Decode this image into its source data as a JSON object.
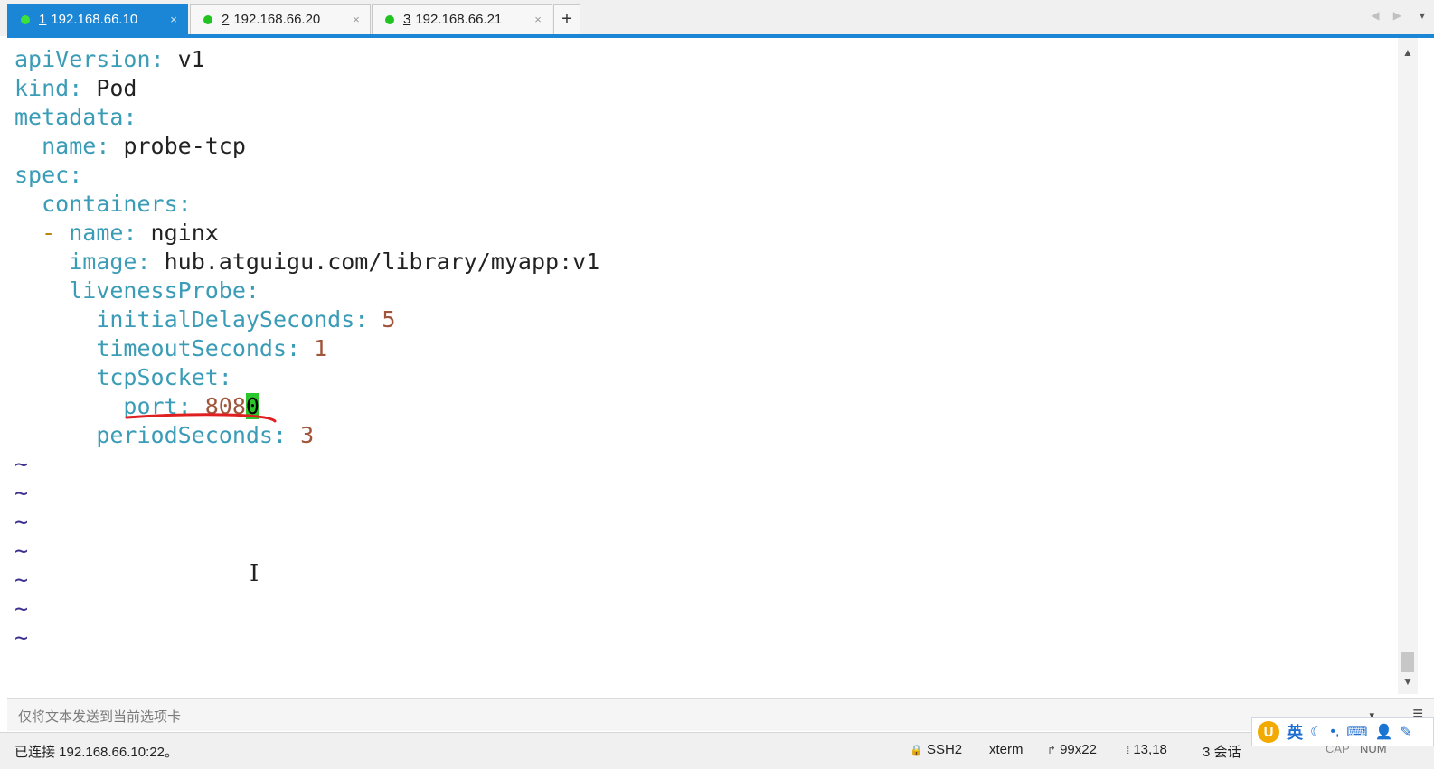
{
  "tabs": [
    {
      "number": "1",
      "label": "192.168.66.10",
      "close": "×"
    },
    {
      "number": "2",
      "label": "192.168.66.20",
      "close": "×"
    },
    {
      "number": "3",
      "label": "192.168.66.21",
      "close": "×"
    }
  ],
  "new_tab": "+",
  "tab_nav": "◀ ▶",
  "tab_menu": "▾",
  "editor": {
    "lines": [
      {
        "key": "apiVersion",
        "sep": ": ",
        "value": "v1"
      },
      {
        "key": "kind",
        "sep": ": ",
        "value": "Pod"
      },
      {
        "key": "metadata",
        "sep": ":"
      },
      {
        "indent": "  ",
        "key": "name",
        "sep": ": ",
        "value": "probe-tcp"
      },
      {
        "key": "spec",
        "sep": ":"
      },
      {
        "indent": "  ",
        "key": "containers",
        "sep": ":"
      },
      {
        "indent": "  ",
        "dash": "- ",
        "key": "name",
        "sep": ": ",
        "value": "nginx"
      },
      {
        "indent": "    ",
        "key": "image",
        "sep": ": ",
        "value": "hub.atguigu.com/library/myapp:v1"
      },
      {
        "indent": "    ",
        "key": "livenessProbe",
        "sep": ":"
      },
      {
        "indent": "      ",
        "key": "initialDelaySeconds",
        "sep": ": ",
        "number": "5"
      },
      {
        "indent": "      ",
        "key": "timeoutSeconds",
        "sep": ": ",
        "number": "1"
      },
      {
        "indent": "      ",
        "key": "tcpSocket",
        "sep": ":"
      },
      {
        "indent": "        ",
        "key": "port",
        "sep": ": ",
        "number": "808",
        "cursor": "0"
      },
      {
        "indent": "      ",
        "key": "periodSeconds",
        "sep": ": ",
        "number": "3"
      }
    ],
    "tilde": "~",
    "tilde_count": 7,
    "highlight_color": "#e02020"
  },
  "sendbar": {
    "placeholder": "仅将文本发送到当前选项卡",
    "dropdown": "▾",
    "menu": "≡"
  },
  "statusbar": {
    "connection": "已连接 192.168.66.10:22。",
    "protocol": "SSH2",
    "term": "xterm",
    "size": "99x22",
    "cursor_pos": "13,18",
    "sessions": "3 会话",
    "cap": "CAP",
    "num": "NUM"
  },
  "ime": {
    "logo": "U",
    "lang": "英",
    "moon": "☾",
    "punct": "•,",
    "keyboard": "⌨",
    "user": "👤",
    "tools": "✎"
  },
  "colors": {
    "tab_active": "#1c86d6",
    "status_dot": "#21c321",
    "yaml_key": "#3a9cb6",
    "yaml_number": "#a0553a",
    "cursor": "#2cc72c",
    "tilde": "#3b2f8f"
  }
}
